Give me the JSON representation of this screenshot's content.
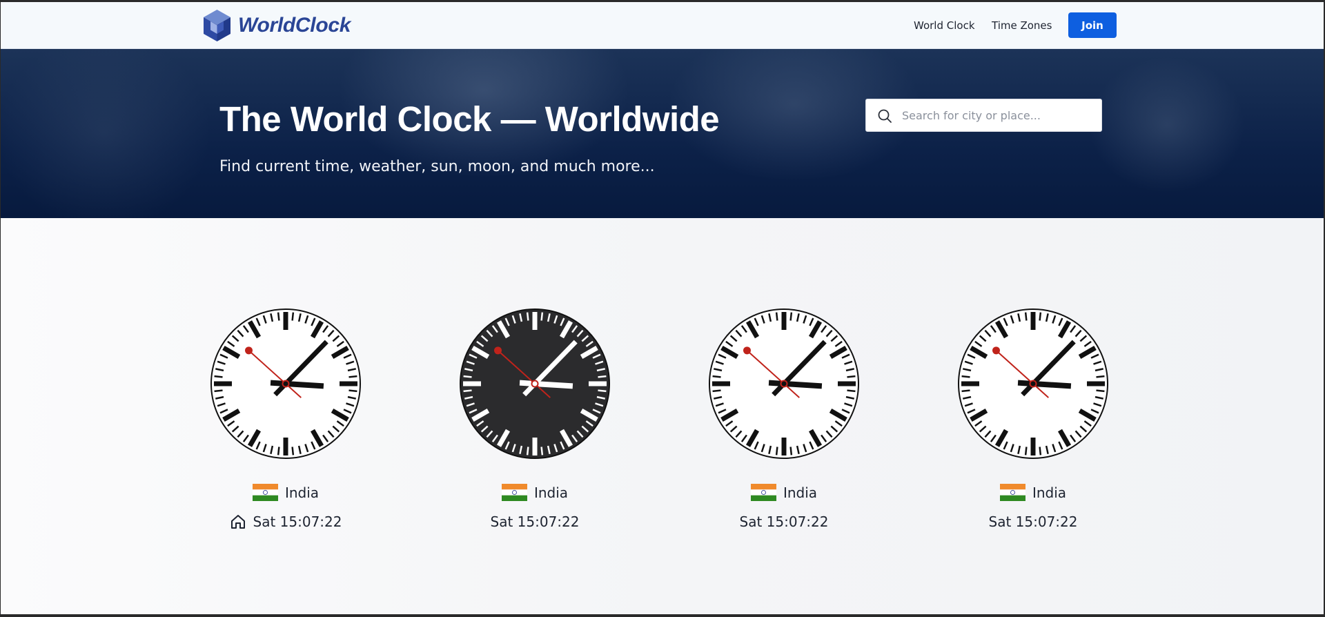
{
  "brand": {
    "name": "WorldClock",
    "logo_icon": "cube-logo-icon",
    "color": "#2a4596"
  },
  "nav": {
    "links": [
      "World Clock",
      "Time Zones"
    ],
    "join_label": "Join",
    "join_color": "#0e5fe0"
  },
  "hero": {
    "title": "The World Clock — Worldwide",
    "subtitle": "Find current time, weather, sun, moon, and much more...",
    "search_placeholder": "Search for city or place...",
    "search_value": ""
  },
  "clocks": [
    {
      "country": "India",
      "time": "Sat 15:07:22",
      "theme": "light",
      "home": true,
      "flag_icon": "india-flag-icon"
    },
    {
      "country": "India",
      "time": "Sat 15:07:22",
      "theme": "dark",
      "home": false,
      "flag_icon": "india-flag-icon"
    },
    {
      "country": "India",
      "time": "Sat 15:07:22",
      "theme": "light",
      "home": false,
      "flag_icon": "india-flag-icon"
    },
    {
      "country": "India",
      "time": "Sat 15:07:22",
      "theme": "light",
      "home": false,
      "flag_icon": "india-flag-icon"
    }
  ],
  "clock_time": {
    "hours": 15,
    "minutes": 7,
    "seconds": 22
  },
  "colors": {
    "second_hand": "#c0231b",
    "dark_face": "#2b2b2d",
    "light_face": "#ffffff"
  }
}
